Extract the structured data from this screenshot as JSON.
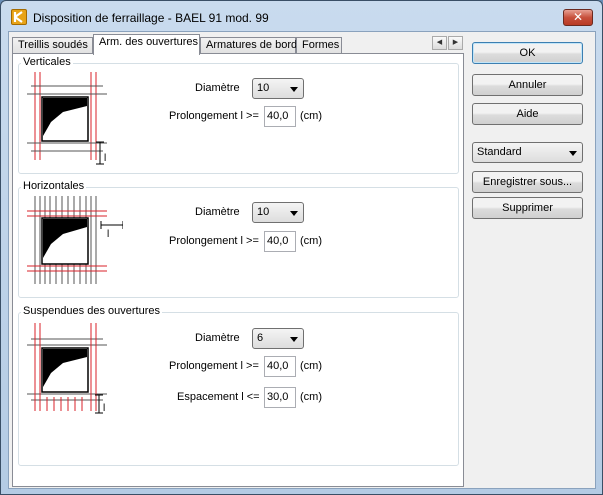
{
  "window": {
    "title": "Disposition de ferraillage - BAEL 91 mod. 99",
    "close_label": "✕"
  },
  "tabs": [
    {
      "label": "Treillis soudés",
      "active": false
    },
    {
      "label": "Arm. des ouvertures",
      "active": true
    },
    {
      "label": "Armatures de bord",
      "active": false
    },
    {
      "label": "Formes",
      "active": false
    }
  ],
  "tab_scroll": {
    "left": "◀",
    "right": "▶"
  },
  "groups": {
    "verticales": {
      "title": "Verticales",
      "diametre_label": "Diamètre",
      "diametre_value": "10",
      "prolongement_label": "Prolongement l >=",
      "prolongement_value": "40,0",
      "unit": "(cm)",
      "diagram_label": "l"
    },
    "horizontales": {
      "title": "Horizontales",
      "diametre_label": "Diamètre",
      "diametre_value": "10",
      "prolongement_label": "Prolongement l >=",
      "prolongement_value": "40,0",
      "unit": "(cm)",
      "diagram_label": "l"
    },
    "suspendues": {
      "title": "Suspendues des ouvertures",
      "diametre_label": "Diamètre",
      "diametre_value": "6",
      "prolongement_label": "Prolongement l >=",
      "prolongement_value": "40,0",
      "prolongement_unit": "(cm)",
      "espacement_label": "Espacement l <=",
      "espacement_value": "30,0",
      "espacement_unit": "(cm)",
      "diagram_label": "l"
    }
  },
  "buttons": {
    "ok": "OK",
    "annuler": "Annuler",
    "aide": "Aide",
    "standard": "Standard",
    "enregistrer": "Enregistrer sous...",
    "supprimer": "Supprimer"
  },
  "colors": {
    "rebar": "#d8202a",
    "titlebar": "#b9cfe6",
    "close": "#c7503c"
  }
}
